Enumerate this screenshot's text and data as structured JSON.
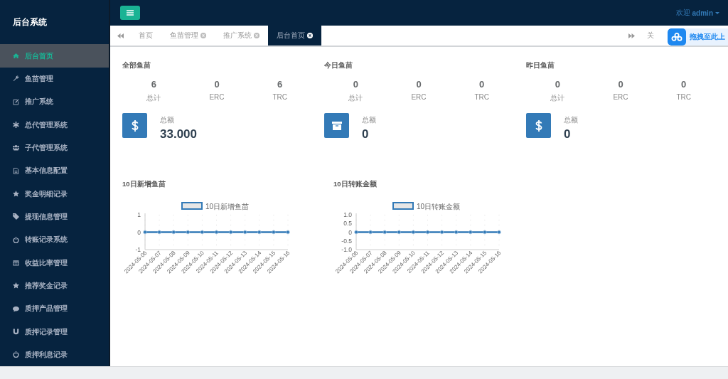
{
  "sidebar": {
    "title": "后台系统",
    "items": [
      {
        "label": "后台首页",
        "selected": true
      },
      {
        "label": "鱼苗管理",
        "selected": false
      },
      {
        "label": "推广系统",
        "selected": false
      },
      {
        "label": "总代管理系统",
        "selected": false
      },
      {
        "label": "子代管理系统",
        "selected": false
      },
      {
        "label": "基本信息配置",
        "selected": false
      },
      {
        "label": "奖金明细记录",
        "selected": false
      },
      {
        "label": "提现信息管理",
        "selected": false
      },
      {
        "label": "转账记录系统",
        "selected": false
      },
      {
        "label": "收益比率管理",
        "selected": false
      },
      {
        "label": "推荐奖金记录",
        "selected": false
      },
      {
        "label": "质押产品管理",
        "selected": false
      },
      {
        "label": "质押记录管理",
        "selected": false
      },
      {
        "label": "质押利息记录",
        "selected": false
      }
    ]
  },
  "header": {
    "welcome": "欢迎",
    "user": "admin"
  },
  "tabs": [
    {
      "label": "首页",
      "closable": false,
      "selected": false
    },
    {
      "label": "鱼苗管理",
      "closable": true,
      "selected": false
    },
    {
      "label": "推广系统",
      "closable": true,
      "selected": false
    },
    {
      "label": "后台首页",
      "closable": true,
      "selected": true
    }
  ],
  "close_tabs": "关",
  "upload_widget": {
    "label": "拖拽至此上"
  },
  "stat_panels": [
    {
      "title": "全部鱼苗",
      "stats": [
        {
          "value": "6",
          "label": "总计"
        },
        {
          "value": "0",
          "label": "ERC"
        },
        {
          "value": "6",
          "label": "TRC"
        }
      ],
      "total_label": "总额",
      "total": "33.000",
      "kind": "dollar"
    },
    {
      "title": "今日鱼苗",
      "stats": [
        {
          "value": "0",
          "label": "总计"
        },
        {
          "value": "0",
          "label": "ERC"
        },
        {
          "value": "0",
          "label": "TRC"
        }
      ],
      "total_label": "总额",
      "total": "0",
      "kind": "archive"
    },
    {
      "title": "昨日鱼苗",
      "stats": [
        {
          "value": "0",
          "label": "总计"
        },
        {
          "value": "0",
          "label": "ERC"
        },
        {
          "value": "0",
          "label": "TRC"
        }
      ],
      "total_label": "总额",
      "total": "0",
      "kind": "dollar"
    }
  ],
  "charts": [
    {
      "title": "10日新增鱼苗",
      "chart_data": {
        "type": "line",
        "grid": true,
        "categories": [
          "2024-05-06",
          "2024-05-07",
          "2024-05-08",
          "2024-05-09",
          "2024-05-10",
          "2024-05-11",
          "2024-05-12",
          "2024-05-13",
          "2024-05-14",
          "2024-05-15",
          "2024-05-16"
        ],
        "ylim": [
          -1,
          1
        ],
        "yticks": [
          -1,
          0,
          1
        ],
        "series": [
          {
            "name": "10日新增鱼苗",
            "color": "#337ab7",
            "marker": true,
            "values": [
              0,
              0,
              0,
              0,
              0,
              0,
              0,
              0,
              0,
              0,
              0
            ]
          }
        ]
      }
    },
    {
      "title": "10日转账金额",
      "chart_data": {
        "type": "line",
        "grid": true,
        "categories": [
          "2024-05-06",
          "2024-05-07",
          "2024-05-08",
          "2024-05-09",
          "2024-05-10",
          "2024-05-11",
          "2024-05-12",
          "2024-05-13",
          "2024-05-14",
          "2024-05-15",
          "2024-05-16"
        ],
        "ylim": [
          -1,
          1
        ],
        "yticks": [
          {
            "value": -1,
            "label": "-1.0"
          },
          {
            "value": -0.5,
            "label": "-0.5"
          },
          {
            "value": 0,
            "label": "0"
          },
          {
            "value": 0.5,
            "label": "0.5"
          },
          {
            "value": 1,
            "label": "1.0"
          }
        ],
        "series": [
          {
            "name": "10日转账金额",
            "color": "#337ab7",
            "marker": true,
            "values": [
              0,
              0,
              0,
              0,
              0,
              0,
              0,
              0,
              0,
              0,
              0
            ]
          }
        ]
      }
    }
  ]
}
